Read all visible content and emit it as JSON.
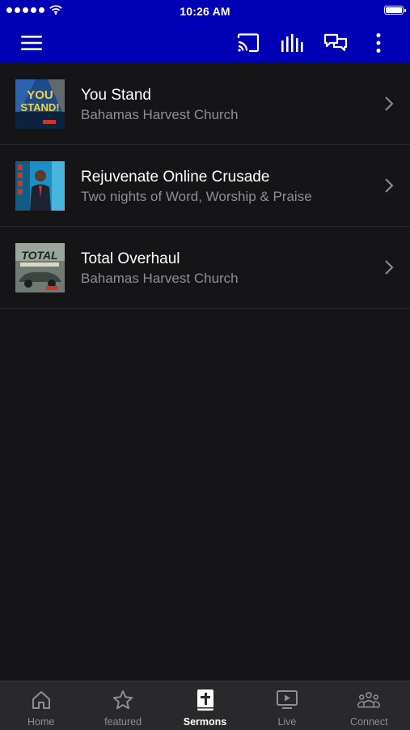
{
  "status_bar": {
    "time": "10:26 AM",
    "signal_dots": 5,
    "battery_level": 1.0
  },
  "toolbar": {
    "icons": [
      "menu-icon",
      "cast-icon",
      "audio-bars-icon",
      "chat-icon",
      "more-vertical-icon"
    ]
  },
  "sermons": [
    {
      "title": "You Stand",
      "subtitle": "Bahamas Harvest Church",
      "thumb_icon": "you-stand-artwork",
      "thumb_text": "YOU STAND!"
    },
    {
      "title": "Rejuvenate Online Crusade",
      "subtitle": "Two nights of Word, Worship & Praise",
      "thumb_icon": "rejuvenate-artwork"
    },
    {
      "title": "Total Overhaul",
      "subtitle": "Bahamas Harvest Church",
      "thumb_icon": "total-overhaul-artwork",
      "thumb_text": "TOTAL"
    }
  ],
  "tabs": [
    {
      "label": "Home",
      "icon": "home-icon",
      "active": false
    },
    {
      "label": "featured",
      "icon": "star-icon",
      "active": false
    },
    {
      "label": "Sermons",
      "icon": "bible-icon",
      "active": true
    },
    {
      "label": "Live",
      "icon": "tv-play-icon",
      "active": false
    },
    {
      "label": "Connect",
      "icon": "people-icon",
      "active": false
    }
  ],
  "colors": {
    "header": "#0000b4",
    "background": "#151517",
    "tabbar": "#29292b",
    "subtitle": "#8e8e93",
    "divider": "#2a2a2d"
  }
}
